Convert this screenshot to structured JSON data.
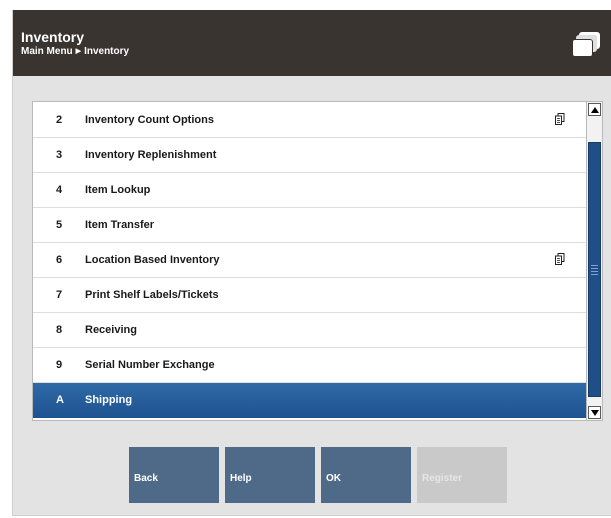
{
  "header": {
    "title": "Inventory",
    "breadcrumb": [
      "Main Menu",
      "Inventory"
    ],
    "app_icon": "windows-stack-icon"
  },
  "menu": {
    "items": [
      {
        "key": "2",
        "label": "Inventory Count Options",
        "submenu": true,
        "selected": false
      },
      {
        "key": "3",
        "label": "Inventory Replenishment",
        "submenu": false,
        "selected": false
      },
      {
        "key": "4",
        "label": "Item Lookup",
        "submenu": false,
        "selected": false
      },
      {
        "key": "5",
        "label": "Item Transfer",
        "submenu": false,
        "selected": false
      },
      {
        "key": "6",
        "label": "Location Based Inventory",
        "submenu": true,
        "selected": false
      },
      {
        "key": "7",
        "label": "Print Shelf Labels/Tickets",
        "submenu": false,
        "selected": false
      },
      {
        "key": "8",
        "label": "Receiving",
        "submenu": false,
        "selected": false
      },
      {
        "key": "9",
        "label": "Serial Number Exchange",
        "submenu": false,
        "selected": false
      },
      {
        "key": "A",
        "label": "Shipping",
        "submenu": false,
        "selected": true
      }
    ],
    "submenu_icon": "submenu-pages-icon"
  },
  "scrollbar": {
    "up_icon": "arrow-up-icon",
    "down_icon": "arrow-down-icon"
  },
  "buttons": {
    "back": "Back",
    "help": "Help",
    "ok": "OK",
    "register": "Register"
  },
  "colors": {
    "header_bg": "#3a3431",
    "selected_row": "#1d5290",
    "button_bg": "#4f6a88",
    "button_disabled": "#c9c9c9",
    "scroll_thumb": "#1f4f86"
  }
}
